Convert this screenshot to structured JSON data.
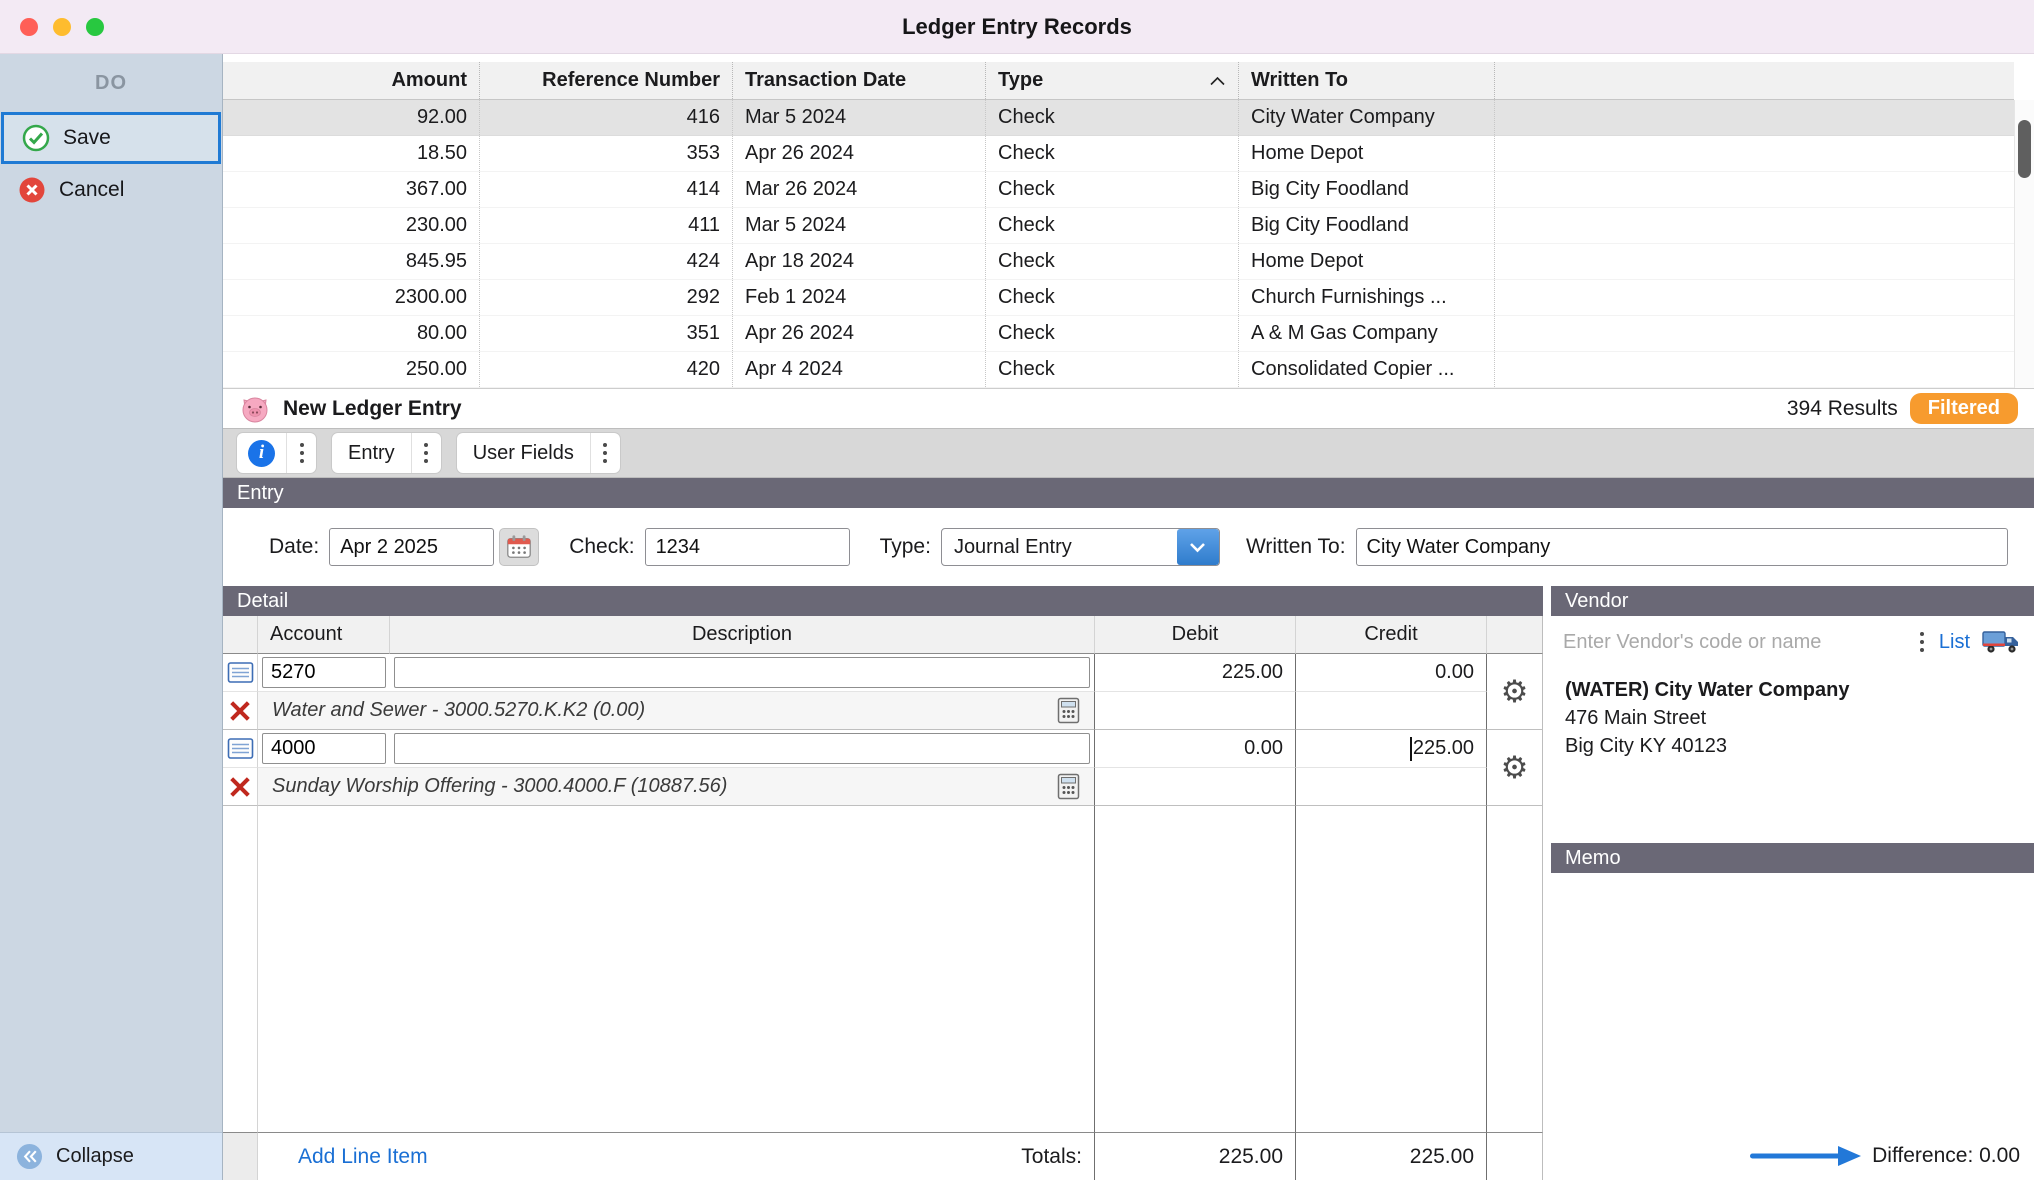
{
  "window": {
    "title": "Ledger Entry Records"
  },
  "sidebar": {
    "header": "DO",
    "save_label": "Save",
    "cancel_label": "Cancel",
    "collapse_label": "Collapse"
  },
  "records": {
    "columns": {
      "amount": "Amount",
      "reference": "Reference Number",
      "date": "Transaction Date",
      "type": "Type",
      "written_to": "Written To"
    },
    "sort_column": "Type",
    "rows": [
      {
        "amount": "92.00",
        "ref": "416",
        "date": "Mar 5 2024",
        "type": "Check",
        "written_to": "City Water Company"
      },
      {
        "amount": "18.50",
        "ref": "353",
        "date": "Apr 26 2024",
        "type": "Check",
        "written_to": "Home Depot"
      },
      {
        "amount": "367.00",
        "ref": "414",
        "date": "Mar 26 2024",
        "type": "Check",
        "written_to": "Big City Foodland"
      },
      {
        "amount": "230.00",
        "ref": "411",
        "date": "Mar 5 2024",
        "type": "Check",
        "written_to": "Big City Foodland"
      },
      {
        "amount": "845.95",
        "ref": "424",
        "date": "Apr 18 2024",
        "type": "Check",
        "written_to": "Home Depot"
      },
      {
        "amount": "2300.00",
        "ref": "292",
        "date": "Feb 1 2024",
        "type": "Check",
        "written_to": "Church Furnishings ..."
      },
      {
        "amount": "80.00",
        "ref": "351",
        "date": "Apr 26 2024",
        "type": "Check",
        "written_to": "A & M Gas Company"
      },
      {
        "amount": "250.00",
        "ref": "420",
        "date": "Apr 4 2024",
        "type": "Check",
        "written_to": "Consolidated Copier ..."
      }
    ]
  },
  "status": {
    "title": "New Ledger Entry",
    "results": "394 Results",
    "filtered": "Filtered"
  },
  "tabs": {
    "entry": "Entry",
    "user_fields": "User Fields"
  },
  "entry": {
    "section_title": "Entry",
    "date_label": "Date:",
    "date_value": "Apr 2 2025",
    "check_label": "Check:",
    "check_value": "1234",
    "type_label": "Type:",
    "type_value": "Journal Entry",
    "written_to_label": "Written To:",
    "written_to_value": "City Water Company"
  },
  "detail": {
    "section_title": "Detail",
    "columns": {
      "account": "Account",
      "description": "Description",
      "debit": "Debit",
      "credit": "Credit"
    },
    "lines": [
      {
        "account": "5270",
        "debit": "225.00",
        "credit": "0.00",
        "info": "Water and Sewer - 3000.5270.K.K2 (0.00)"
      },
      {
        "account": "4000",
        "debit": "0.00",
        "credit": "225.00",
        "info": "Sunday Worship Offering - 3000.4000.F (10887.56)"
      }
    ],
    "add_line_label": "Add Line Item",
    "totals_label": "Totals:",
    "total_debit": "225.00",
    "total_credit": "225.00"
  },
  "vendor": {
    "section_title": "Vendor",
    "search_placeholder": "Enter Vendor's code or name",
    "list_label": "List",
    "name": "(WATER) City Water Company",
    "address1": "476 Main Street",
    "address2": "Big City KY 40123"
  },
  "memo": {
    "section_title": "Memo"
  },
  "footer": {
    "difference": "Difference: 0.00"
  },
  "colors": {
    "accent_blue": "#1a6fd4",
    "filtered_orange": "#f79b2e",
    "section_band": "#6a6876",
    "save_border": "#1f7ad4",
    "selected_row": "#e3e3e3"
  }
}
